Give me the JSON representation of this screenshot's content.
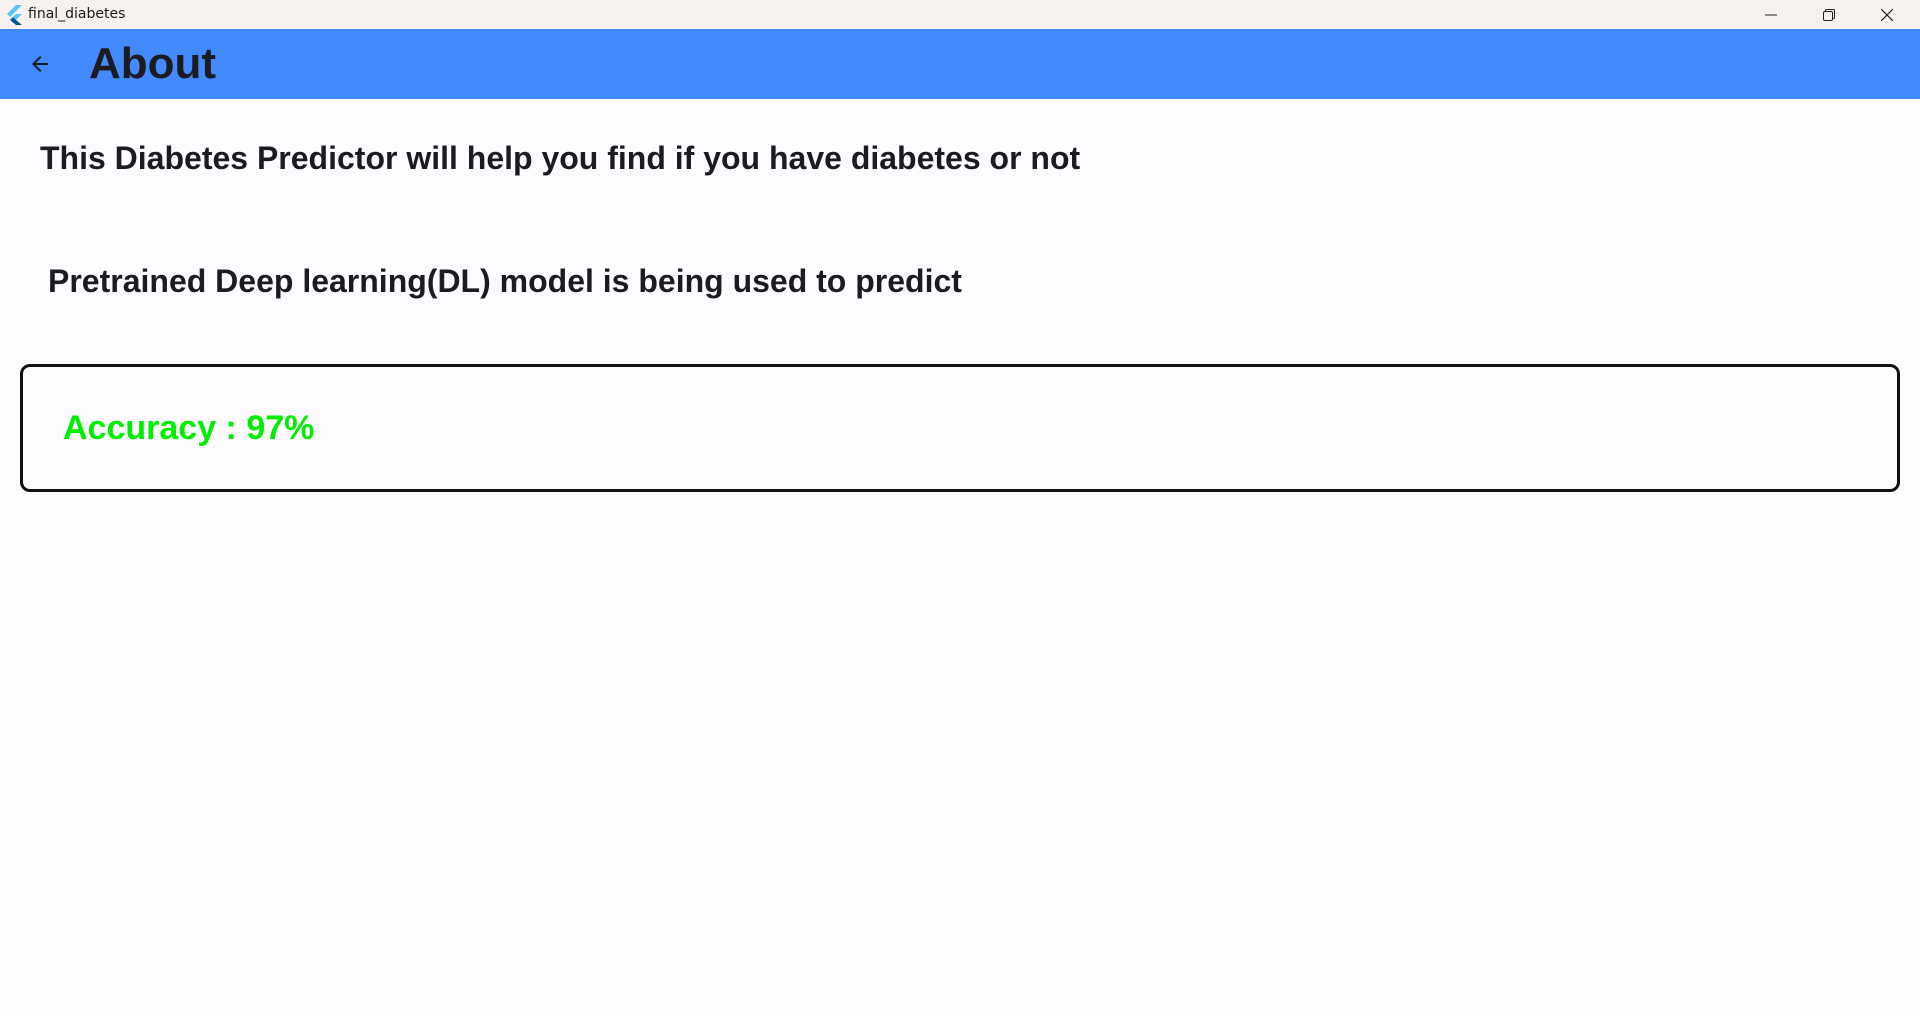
{
  "window": {
    "title": "final_diabetes",
    "icon": "flutter-icon"
  },
  "appbar": {
    "back_icon": "arrow-left-icon",
    "title": "About",
    "color": "#448aff"
  },
  "content": {
    "description_1": "This Diabetes Predictor will help you find if you have diabetes or not",
    "description_2": "Pretrained Deep learning(DL) model is being used to predict",
    "accuracy_label": "Accuracy : 97%",
    "accuracy_color": "#00ee00"
  }
}
